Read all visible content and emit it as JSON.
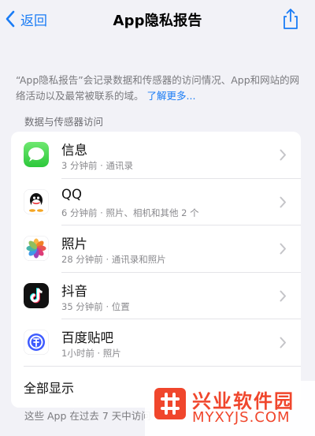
{
  "nav": {
    "back_label": "返回",
    "title": "App隐私报告"
  },
  "intro": {
    "text": "“App隐私报告”会记录数据和传感器的访问情况、App和网站的网络活动以及最常被联系的域。",
    "more": "了解更多..."
  },
  "section": {
    "title": "数据与传感器访问"
  },
  "apps": [
    {
      "name": "信息",
      "detail": "3 分钟前 · 通讯录",
      "icon": "messages-app-icon"
    },
    {
      "name": "QQ",
      "detail": "6 分钟前 · 照片、相机和其他 2 个",
      "icon": "qq-app-icon"
    },
    {
      "name": "照片",
      "detail": "28 分钟前 · 通讯录和照片",
      "icon": "photos-app-icon"
    },
    {
      "name": "抖音",
      "detail": "35 分钟前 · 位置",
      "icon": "douyin-app-icon"
    },
    {
      "name": "百度贴吧",
      "detail": "1小时前 · 照片",
      "icon": "baidu-tieba-app-icon"
    }
  ],
  "show_all": "全部显示",
  "footer_note": "这些 App 在过去 7 天中访问",
  "watermark": {
    "title": "兴业软件园",
    "url": "MYXYJS.COM"
  },
  "colors": {
    "accent": "#1a7cf5",
    "background": "#f2f2f7",
    "watermark": "#f0462c"
  }
}
